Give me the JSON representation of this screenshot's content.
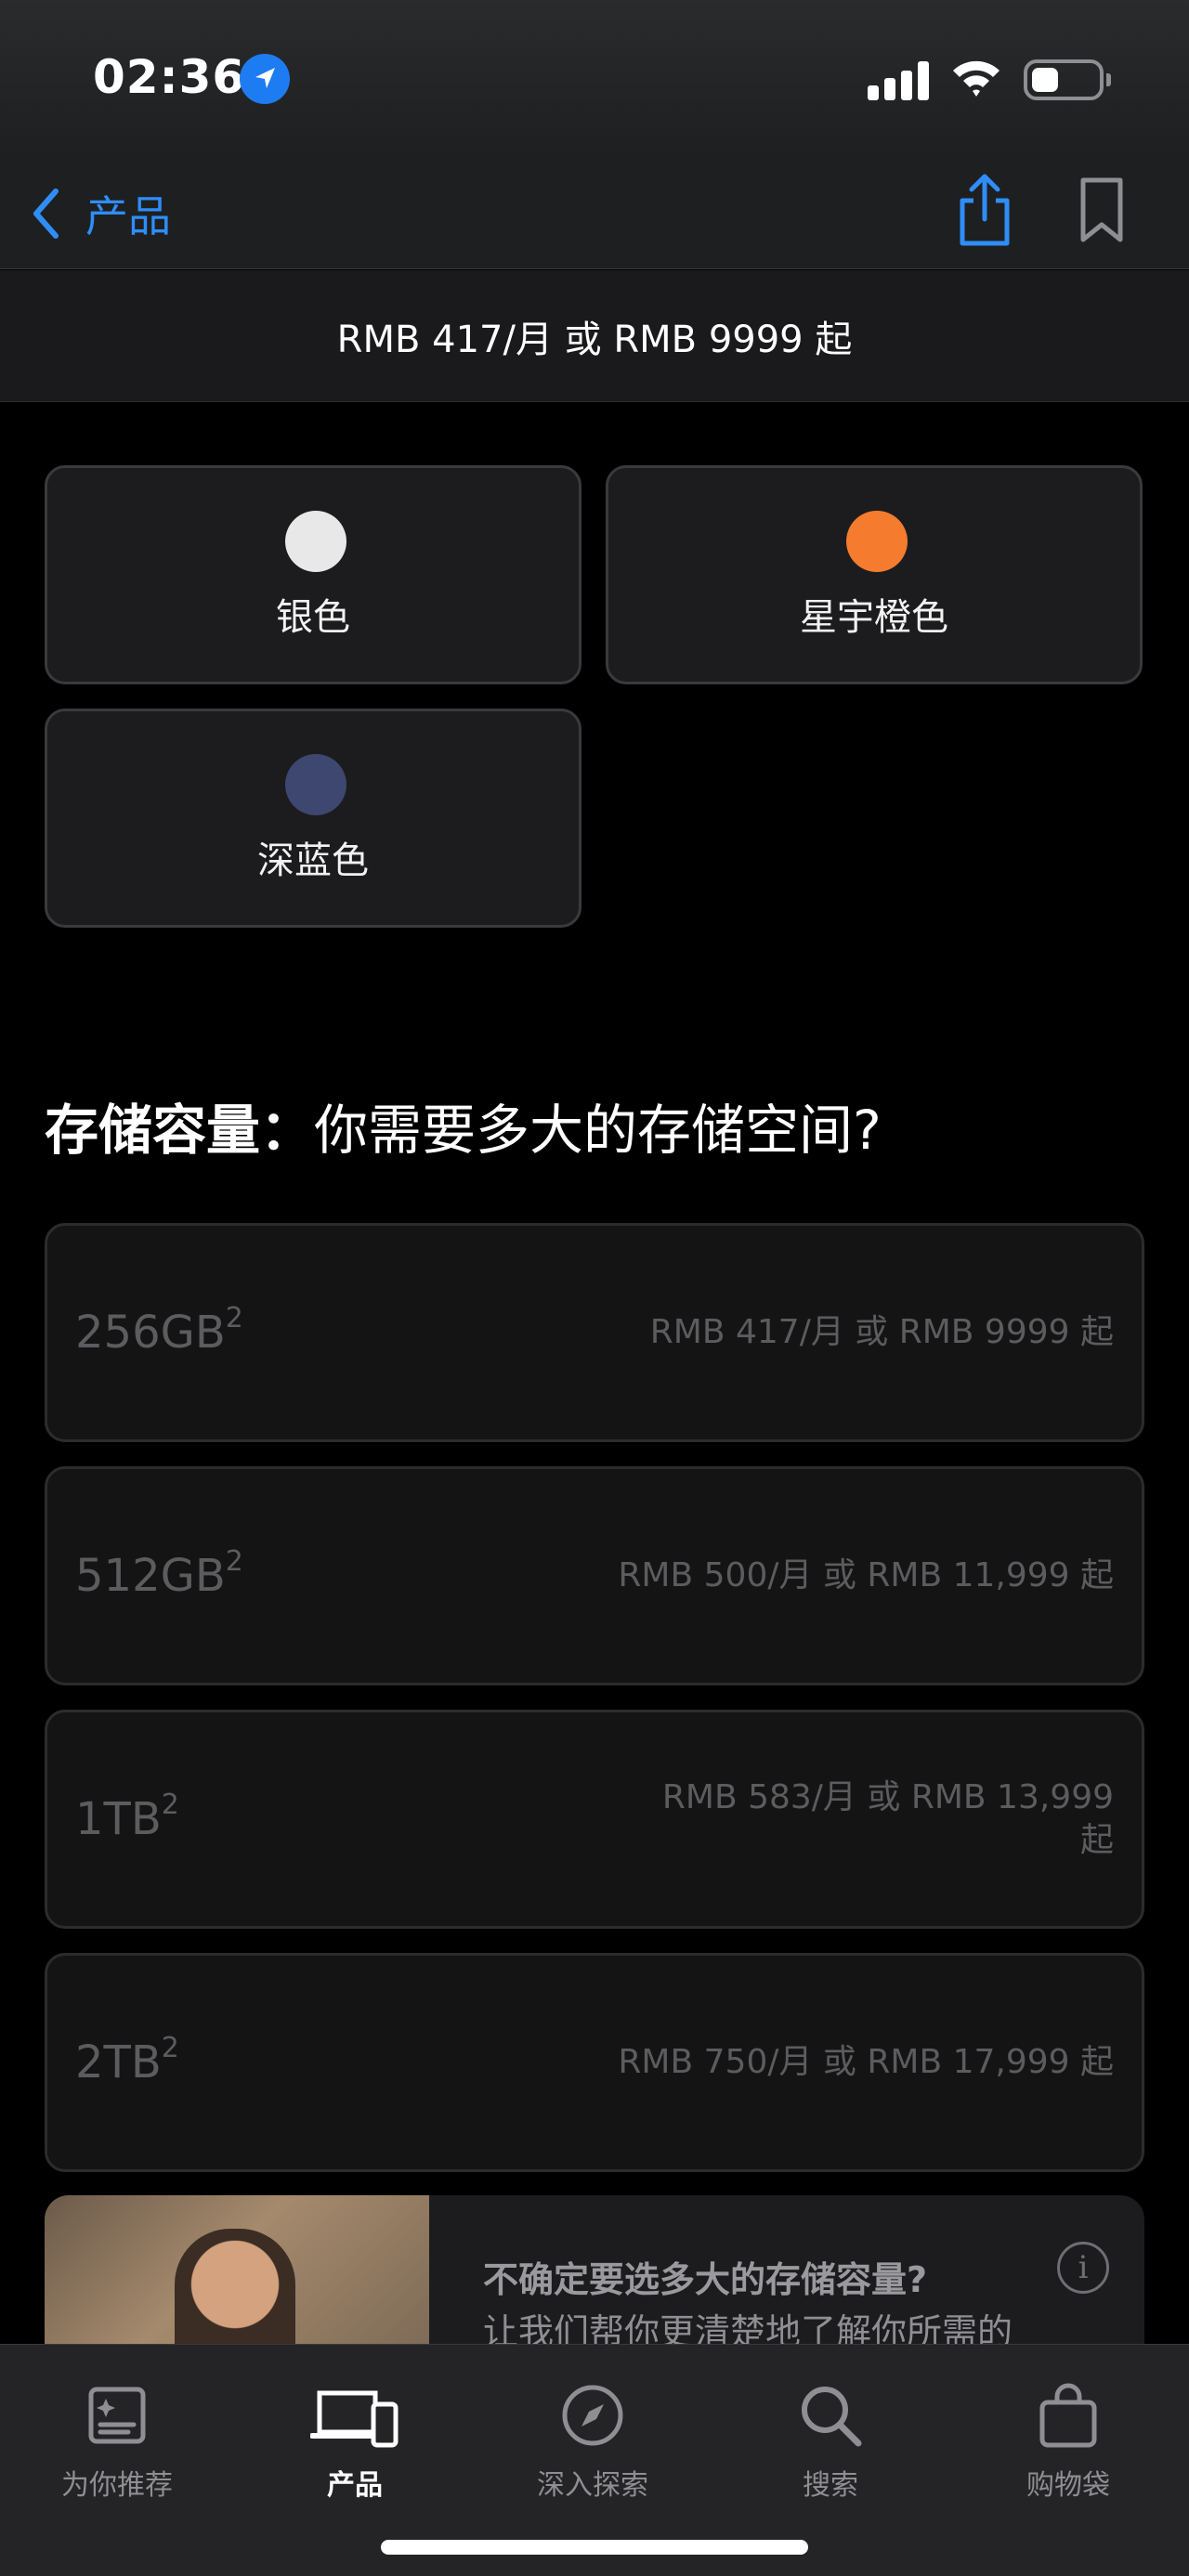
{
  "status_bar": {
    "time": "02:36"
  },
  "nav": {
    "back_label": "产品"
  },
  "price_summary": "RMB 417/月 或 RMB 9999 起",
  "colors": [
    {
      "label": "银色",
      "swatch": "#e8e8e8"
    },
    {
      "label": "星宇橙色",
      "swatch": "#f57c2e"
    },
    {
      "label": "深蓝色",
      "swatch": "#3d4770"
    }
  ],
  "storage": {
    "heading_bold": "存储容量：",
    "heading_text": "你需要多大的存储空间?",
    "options": [
      {
        "size": "256GB",
        "note": "2",
        "price": "RMB 417/月 或 RMB 9999 起"
      },
      {
        "size": "512GB",
        "note": "2",
        "price": "RMB 500/月 或 RMB 11,999 起"
      },
      {
        "size": "1TB",
        "note": "2",
        "price": "RMB 583/月 或 RMB 13,999 起"
      },
      {
        "size": "2TB",
        "note": "2",
        "price": "RMB 750/月 或 RMB 17,999 起"
      }
    ]
  },
  "help_card": {
    "title": "不确定要选多大的存储容量?",
    "text": "让我们帮你更清楚地了解你所需的"
  },
  "tabs": [
    {
      "label": "为你推荐",
      "icon": "recommend-icon"
    },
    {
      "label": "产品",
      "icon": "products-icon"
    },
    {
      "label": "深入探索",
      "icon": "compass-icon"
    },
    {
      "label": "搜索",
      "icon": "search-icon"
    },
    {
      "label": "购物袋",
      "icon": "bag-icon"
    }
  ],
  "accent_color": "#2f8df7"
}
